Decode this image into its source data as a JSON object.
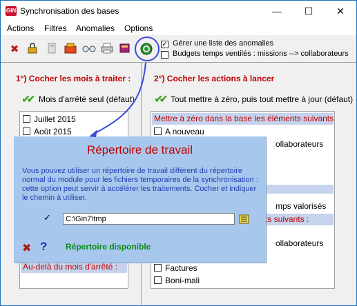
{
  "window": {
    "app_logo": "GIN",
    "title": "Synchronisation des bases",
    "controls": {
      "minimize": "—",
      "maximize": "☐",
      "close": "✕"
    }
  },
  "menu": [
    "Actions",
    "Filtres",
    "Anomalies",
    "Options"
  ],
  "toolbar": {
    "options": [
      {
        "label": "Gérer une liste des anomalies",
        "checked": true
      },
      {
        "label": "Budgets temps ventilés : missions --> collaborateurs",
        "checked": false
      }
    ]
  },
  "left_panel": {
    "heading": "1°) Cocher les mois à traiter :",
    "quick_action": "Mois d'arrêté seul (défaut)",
    "months": [
      {
        "label": "Juillet 2015",
        "checked": false
      },
      {
        "label": "Août 2015",
        "checked": false
      }
    ],
    "footer_section": "Au-delà du mois d'arrêté :"
  },
  "right_panel": {
    "heading": "2°) Cocher les actions à lancer",
    "quick_action": "Tout mettre à zéro, puis tout mettre à jour (défaut)",
    "section_reset": "Mettre à zéro dans la base les éléments suivants :",
    "items_top": [
      {
        "label": "A nouveau",
        "checked": false
      }
    ],
    "partial": {
      "collab1": "ollaborateurs",
      "temps": "mps valorisés",
      "suivants": "ts suivants :",
      "collab2": "ollaborateurs"
    },
    "items_bottom": [
      {
        "label": "Factures",
        "checked": false
      },
      {
        "label": "Boni-mali",
        "checked": false
      }
    ]
  },
  "dialog": {
    "title": "Répertoire de travail",
    "text": "Vous pouvez utiliser un répertoire de travail différent du répertoire normal du module pour les fichiers temporaires de la synchronisation : cette option peut servir à accélérer les traitements. Cocher et indiquer le chemin à utiliser.",
    "use_custom": true,
    "path": "C:\\Gin7\\tmp",
    "status": "Répertoire disponible",
    "cancel_glyph": "✖",
    "help_glyph": "?"
  },
  "colors": {
    "accent_red": "#c00000",
    "dialog_bg": "#a7c7ec",
    "section_bg": "#c5d3ec",
    "annotation_blue": "#3b4bd8",
    "status_green": "#0b8a1c"
  }
}
